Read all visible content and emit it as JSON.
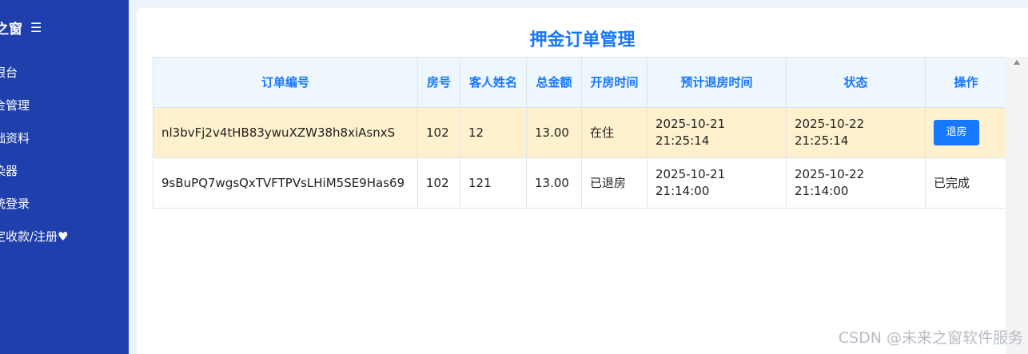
{
  "sidebar": {
    "brand": "之窗",
    "menu_icon": "☰",
    "items": [
      {
        "label": "银台"
      },
      {
        "label": "金管理"
      },
      {
        "label": "础资料"
      },
      {
        "label": "染器"
      },
      {
        "label": "统登录"
      },
      {
        "label": "定收款/注册♥"
      }
    ]
  },
  "main": {
    "title": "押金订单管理",
    "columns": [
      "订单编号",
      "房号",
      "客人姓名",
      "总金额",
      "开房时间",
      "预计退房时间",
      "状态",
      "操作"
    ],
    "rows": [
      {
        "order_no": "nl3bvFj2v4tHB83ywuXZW38h8xiAsnxS",
        "room": "102",
        "guest": "12",
        "total": "13.00",
        "status": "在住",
        "checkin_date": "2025-10-21",
        "checkin_time": "21:25:14",
        "checkout_date": "2025-10-22",
        "checkout_time": "21:25:14",
        "action": "退房"
      },
      {
        "order_no": "9sBuPQ7wgsQxTVFTPVsLHiM5SE9Has69",
        "room": "102",
        "guest": "121",
        "total": "13.00",
        "status": "已退房",
        "checkin_date": "2025-10-21",
        "checkin_time": "21:14:00",
        "checkout_date": "2025-10-22",
        "checkout_time": "21:14:00",
        "action_status": "已完成"
      }
    ]
  },
  "watermark": "CSDN @未来之窗软件服务",
  "colors": {
    "sidebar": "#1f3fad",
    "accent": "#1677ff",
    "highlight_row": "#fff1cd",
    "header_bg": "#eef6fe"
  }
}
